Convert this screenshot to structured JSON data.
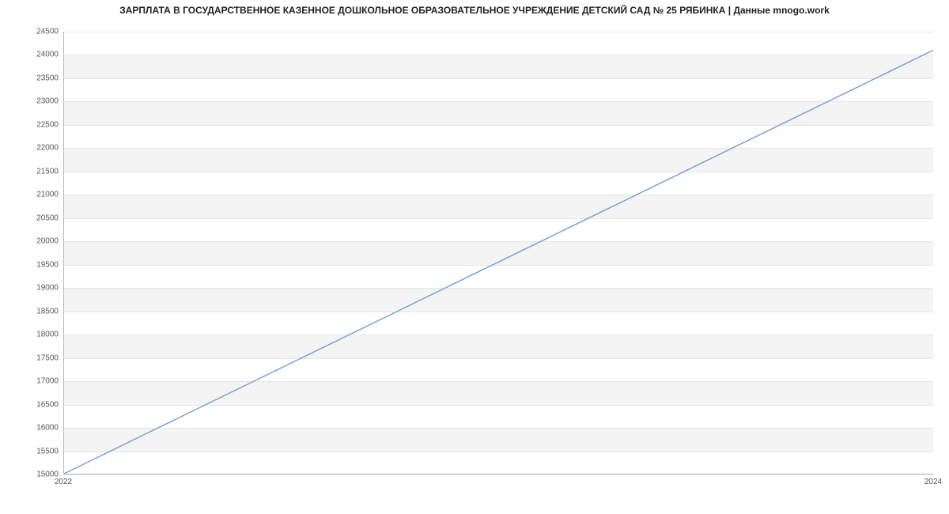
{
  "chart_data": {
    "type": "line",
    "title": "ЗАРПЛАТА В ГОСУДАРСТВЕННОЕ КАЗЕННОЕ ДОШКОЛЬНОЕ ОБРАЗОВАТЕЛЬНОЕ УЧРЕЖДЕНИЕ ДЕТСКИЙ САД № 25 РЯБИНКА | Данные mnogo.work",
    "xlabel": "",
    "ylabel": "",
    "x": [
      2022,
      2024
    ],
    "values": [
      15000,
      24100
    ],
    "xlim": [
      2022,
      2024
    ],
    "ylim": [
      15000,
      24500
    ],
    "y_ticks": [
      15000,
      15500,
      16000,
      16500,
      17000,
      17500,
      18000,
      18500,
      19000,
      19500,
      20000,
      20500,
      21000,
      21500,
      22000,
      22500,
      23000,
      23500,
      24000,
      24500
    ],
    "x_ticks": [
      2022,
      2024
    ],
    "line_color": "#6f9fd8",
    "band_color": "#f4f4f4"
  }
}
